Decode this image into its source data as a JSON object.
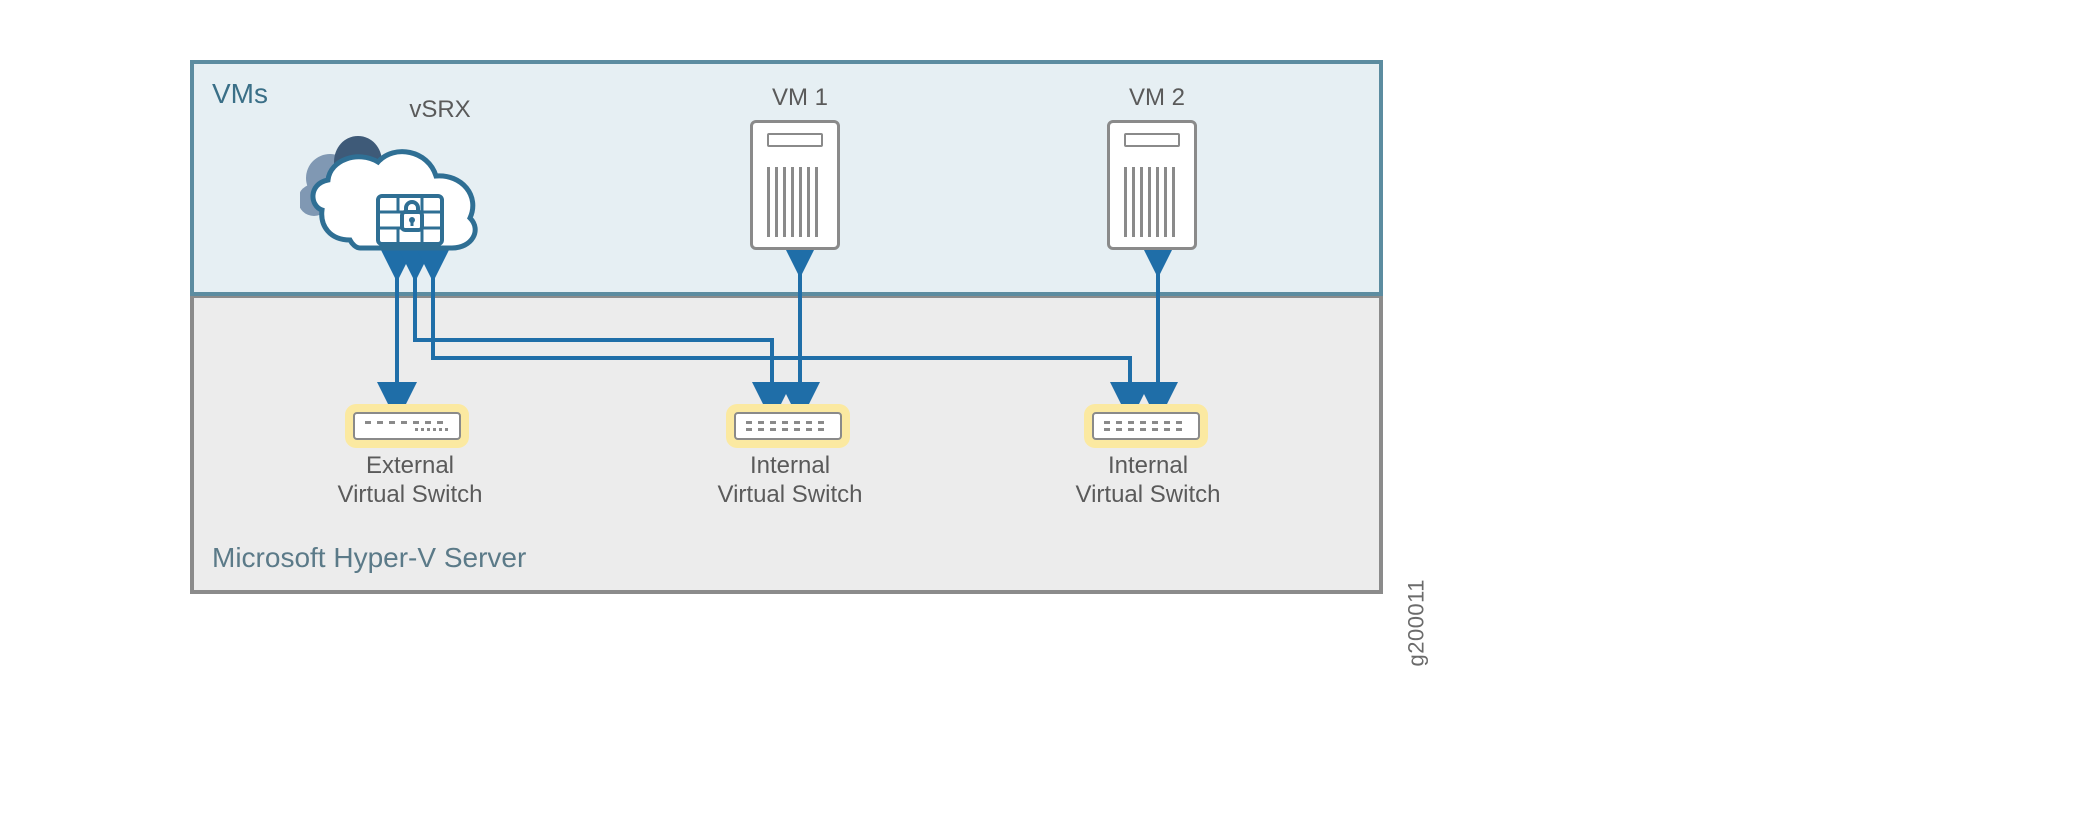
{
  "panels": {
    "vms_label": "VMs",
    "hyperv_label": "Microsoft Hyper-V Server"
  },
  "nodes": {
    "vsrx_label": "vSRX",
    "vm1_label": "VM 1",
    "vm2_label": "VM 2"
  },
  "switches": {
    "external": {
      "line1": "External",
      "line2": "Virtual Switch"
    },
    "internal1": {
      "line1": "Internal",
      "line2": "Virtual Switch"
    },
    "internal2": {
      "line1": "Internal",
      "line2": "Virtual Switch"
    }
  },
  "figure_id": "g200011",
  "colors": {
    "arrow": "#1f6ea8",
    "panel_vms_border": "#5c8ca0",
    "panel_hyperv_border": "#8b8b8b",
    "highlight": "#fbe9a1"
  }
}
